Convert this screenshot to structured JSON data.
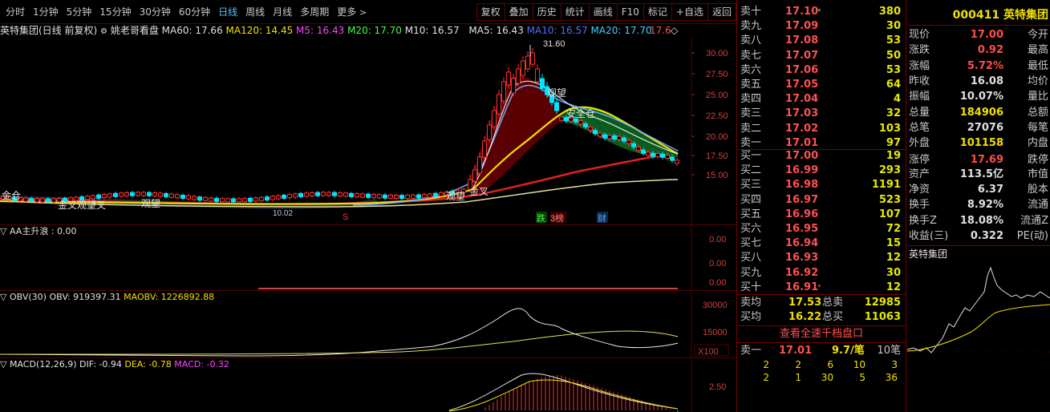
{
  "toolbar": {
    "periods": [
      "分时",
      "1分钟",
      "5分钟",
      "15分钟",
      "30分钟",
      "60分钟",
      "日线",
      "周线",
      "月线",
      "多周期",
      "更多"
    ],
    "active_period": "日线",
    "tools": [
      "复权",
      "叠加",
      "历史",
      "统计",
      "画线",
      "F10",
      "标记",
      "+自选",
      "返回"
    ]
  },
  "main_chart": {
    "stock_label": "英特集团(日线 前复权)",
    "indicator_name": "姚老哥看盘",
    "ma60": "MA60: 17.66",
    "ma120": "MA120: 14.45",
    "m5": "M5: 16.43",
    "m20": "M20: 17.70",
    "m10": "M10: 16.57",
    "ma5": "MA5: 16.43",
    "ma10": "MA10: 16.57",
    "ma20": "MA20: 17.70",
    "last": "17.6",
    "high_marker": "31.60",
    "low_marker": "10.02",
    "y_ticks": [
      "30.00",
      "27.50",
      "25.00",
      "22.50",
      "20.00",
      "17.50",
      "15.00"
    ],
    "annotations": {
      "jinjiao1": "金叉观望叉",
      "guanwang": "观望",
      "jinjiao2": "金叉",
      "jincang": "金仓",
      "guanwang2": "观望",
      "ancang": "安全仓",
      "jinchang": "金仓",
      "die": "跌",
      "bang": "3榜",
      "cai": "财",
      "s": "S"
    }
  },
  "aa_panel": {
    "label": "AA主升浪 : 0.00",
    "y_ticks": [
      "0.00",
      "0.00",
      "0.00"
    ]
  },
  "obv_panel": {
    "label": "OBV(30)",
    "obv": "OBV: 919397.31",
    "maobv": "MAOBV: 1226892.88",
    "y_ticks": [
      "30000",
      "15000"
    ],
    "unit": "X100"
  },
  "macd_panel": {
    "label": "MACD(12,26,9)",
    "dif": "DIF: -0.94",
    "dea": "DEA: -0.78",
    "macd": "MACD: -0.32",
    "y_ticks": [
      "2.50"
    ]
  },
  "orderbook": {
    "asks": [
      {
        "label": "卖十",
        "price": "17.10",
        "vol": "380",
        "mark": "*"
      },
      {
        "label": "卖九",
        "price": "17.09",
        "vol": "30",
        "mark": ""
      },
      {
        "label": "卖八",
        "price": "17.08",
        "vol": "53",
        "mark": ""
      },
      {
        "label": "卖七",
        "price": "17.07",
        "vol": "50",
        "mark": ""
      },
      {
        "label": "卖六",
        "price": "17.06",
        "vol": "53",
        "mark": ""
      },
      {
        "label": "卖五",
        "price": "17.05",
        "vol": "64",
        "mark": ""
      },
      {
        "label": "卖四",
        "price": "17.04",
        "vol": "4",
        "mark": ""
      },
      {
        "label": "卖三",
        "price": "17.03",
        "vol": "32",
        "mark": ""
      },
      {
        "label": "卖二",
        "price": "17.02",
        "vol": "103",
        "mark": ""
      },
      {
        "label": "卖一",
        "price": "17.01",
        "vol": "97",
        "mark": ""
      }
    ],
    "bids": [
      {
        "label": "买一",
        "price": "17.00",
        "vol": "19",
        "mark": ""
      },
      {
        "label": "买二",
        "price": "16.99",
        "vol": "293",
        "mark": ""
      },
      {
        "label": "买三",
        "price": "16.98",
        "vol": "1191",
        "mark": ""
      },
      {
        "label": "买四",
        "price": "16.97",
        "vol": "523",
        "mark": ""
      },
      {
        "label": "买五",
        "price": "16.96",
        "vol": "107",
        "mark": ""
      },
      {
        "label": "买六",
        "price": "16.95",
        "vol": "72",
        "mark": ""
      },
      {
        "label": "买七",
        "price": "16.94",
        "vol": "15",
        "mark": ""
      },
      {
        "label": "买八",
        "price": "16.93",
        "vol": "12",
        "mark": ""
      },
      {
        "label": "买九",
        "price": "16.92",
        "vol": "30",
        "mark": ""
      },
      {
        "label": "买十",
        "price": "16.91",
        "vol": "12",
        "mark": "*"
      }
    ],
    "avg_ask_label": "卖均",
    "avg_ask": "17.53",
    "total_ask_label": "总卖",
    "total_ask": "12985",
    "avg_bid_label": "买均",
    "avg_bid": "16.22",
    "total_bid_label": "总买",
    "total_bid": "11063",
    "view_full": "查看全速千档盘口",
    "queue_label": "卖一",
    "queue_price": "17.01",
    "queue_avg": "9.7/笔",
    "queue_count": "10笔",
    "queue_row1": [
      "2",
      "2",
      "6",
      "10",
      "3"
    ],
    "queue_row2": [
      "2",
      "1",
      "30",
      "5",
      "36"
    ]
  },
  "quote": {
    "code": "000411",
    "name": "英特集团",
    "rows": [
      {
        "l": "现价",
        "v": "17.00",
        "r": "今开",
        "c": "red"
      },
      {
        "l": "涨跌",
        "v": "0.92",
        "r": "最高",
        "c": "red"
      },
      {
        "l": "涨幅",
        "v": "5.72%",
        "r": "最低",
        "c": "red"
      },
      {
        "l": "昨收",
        "v": "16.08",
        "r": "均价",
        "c": "wht"
      },
      {
        "l": "振幅",
        "v": "10.07%",
        "r": "量比",
        "c": "wht"
      },
      {
        "l": "总量",
        "v": "184906",
        "r": "总额",
        "c": "yel"
      },
      {
        "l": "总笔",
        "v": "27076",
        "r": "每笔",
        "c": "wht"
      },
      {
        "l": "外盘",
        "v": "101158",
        "r": "内盘",
        "c": "yel"
      },
      {
        "l": "涨停",
        "v": "17.69",
        "r": "跌停",
        "c": "red"
      },
      {
        "l": "资产",
        "v": "113.5亿",
        "r": "市值",
        "c": "wht"
      },
      {
        "l": "净资",
        "v": "6.37",
        "r": "股本",
        "c": "wht"
      },
      {
        "l": "换手",
        "v": "8.92%",
        "r": "流通",
        "c": "wht"
      },
      {
        "l": "换手Z",
        "v": "18.08%",
        "r": "流通Z",
        "c": "wht"
      },
      {
        "l": "收益(三)",
        "v": "0.322",
        "r": "PE(动)",
        "c": "wht"
      }
    ],
    "mini_title": "英特集团"
  },
  "colors": {
    "up": "#ff4d4d",
    "down": "#00ffff",
    "ma_yellow": "#f0e000",
    "ma_red": "#e02020",
    "ma_white": "#e8e8e8",
    "ma_blue": "#6aa8ff",
    "grid": "#5a0000"
  }
}
